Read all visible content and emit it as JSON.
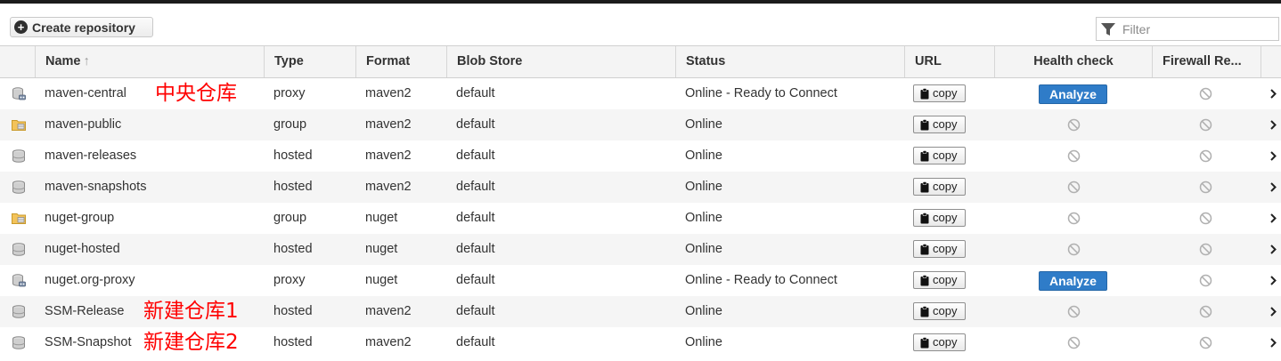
{
  "toolbar": {
    "create_label": "Create repository",
    "filter_placeholder": "Filter"
  },
  "columns": {
    "name": "Name",
    "sort_indicator": "↑",
    "type": "Type",
    "format": "Format",
    "blob_store": "Blob Store",
    "status": "Status",
    "url": "URL",
    "health_check": "Health check",
    "firewall": "Firewall Re..."
  },
  "labels": {
    "copy": "copy",
    "analyze": "Analyze"
  },
  "colors": {
    "analyze_button": "#2f7cc8",
    "annotation": "#ff0000",
    "alt_row": "#f5f5f5"
  },
  "rows": [
    {
      "icon": "proxy-repo-icon",
      "name": "maven-central",
      "annotation": "中央仓库",
      "type": "proxy",
      "format": "maven2",
      "blob_store": "default",
      "status": "Online - Ready to Connect",
      "health": "analyze"
    },
    {
      "icon": "group-repo-icon",
      "name": "maven-public",
      "annotation": "",
      "type": "group",
      "format": "maven2",
      "blob_store": "default",
      "status": "Online",
      "health": "disabled"
    },
    {
      "icon": "hosted-repo-icon",
      "name": "maven-releases",
      "annotation": "",
      "type": "hosted",
      "format": "maven2",
      "blob_store": "default",
      "status": "Online",
      "health": "disabled"
    },
    {
      "icon": "hosted-repo-icon",
      "name": "maven-snapshots",
      "annotation": "",
      "type": "hosted",
      "format": "maven2",
      "blob_store": "default",
      "status": "Online",
      "health": "disabled"
    },
    {
      "icon": "group-repo-icon",
      "name": "nuget-group",
      "annotation": "",
      "type": "group",
      "format": "nuget",
      "blob_store": "default",
      "status": "Online",
      "health": "disabled"
    },
    {
      "icon": "hosted-repo-icon",
      "name": "nuget-hosted",
      "annotation": "",
      "type": "hosted",
      "format": "nuget",
      "blob_store": "default",
      "status": "Online",
      "health": "disabled"
    },
    {
      "icon": "proxy-repo-icon",
      "name": "nuget.org-proxy",
      "annotation": "",
      "type": "proxy",
      "format": "nuget",
      "blob_store": "default",
      "status": "Online - Ready to Connect",
      "health": "analyze"
    },
    {
      "icon": "hosted-repo-icon",
      "name": "SSM-Release",
      "annotation": "新建仓库1",
      "type": "hosted",
      "format": "maven2",
      "blob_store": "default",
      "status": "Online",
      "health": "disabled"
    },
    {
      "icon": "hosted-repo-icon",
      "name": "SSM-Snapshot",
      "annotation": "新建仓库2",
      "type": "hosted",
      "format": "maven2",
      "blob_store": "default",
      "status": "Online",
      "health": "disabled"
    }
  ]
}
